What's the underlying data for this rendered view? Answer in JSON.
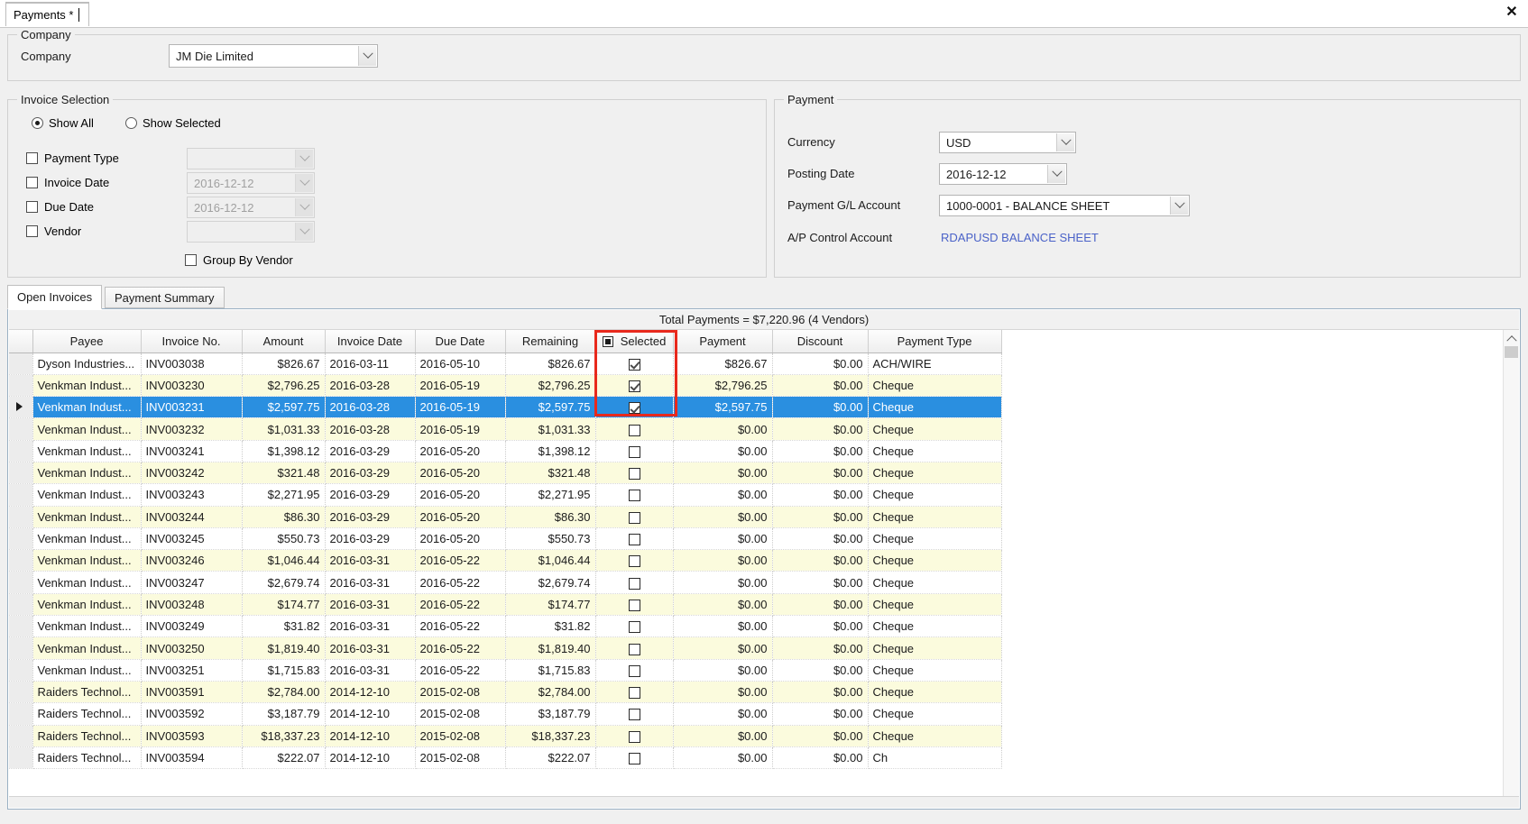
{
  "window": {
    "tab_label": "Payments *",
    "close_label": "✕"
  },
  "company_section": {
    "group_title": "Company",
    "label": "Company",
    "value": "JM Die Limited"
  },
  "invoice_selection": {
    "group_title": "Invoice Selection",
    "radio_show_all": "Show All",
    "radio_show_selected": "Show Selected",
    "filters": [
      {
        "label": "Payment Type",
        "value": "",
        "checked": false,
        "disabled": true
      },
      {
        "label": "Invoice Date",
        "value": "2016-12-12",
        "checked": false,
        "disabled": true
      },
      {
        "label": "Due Date",
        "value": "2016-12-12",
        "checked": false,
        "disabled": true
      },
      {
        "label": "Vendor",
        "value": "",
        "checked": false,
        "disabled": true
      }
    ],
    "group_by_vendor": "Group By Vendor"
  },
  "payment_section": {
    "group_title": "Payment",
    "currency_label": "Currency",
    "currency_value": "USD",
    "posting_date_label": "Posting Date",
    "posting_date_value": "2016-12-12",
    "gl_account_label": "Payment G/L Account",
    "gl_account_value": "1000-0001 - BALANCE SHEET",
    "ap_control_label": "A/P Control Account",
    "ap_control_value": "RDAPUSD BALANCE SHEET",
    "link_color": "#4a62c8"
  },
  "lower_tabs": [
    {
      "label": "Open Invoices",
      "active": true
    },
    {
      "label": "Payment Summary",
      "active": false
    }
  ],
  "grid": {
    "summary": "Total Payments = $7,220.96 (4 Vendors)",
    "columns": [
      "Payee",
      "Invoice No.",
      "Amount",
      "Invoice Date",
      "Due Date",
      "Remaining",
      "Selected",
      "Payment",
      "Discount",
      "Payment Type"
    ],
    "select_all_state": "indeterminate",
    "rows": [
      {
        "payee": "Dyson Industries...",
        "invoice_no": "INV003038",
        "amount": "$826.67",
        "invoice_date": "2016-03-11",
        "due_date": "2016-05-10",
        "remaining": "$826.67",
        "selected": true,
        "payment": "$826.67",
        "discount": "$0.00",
        "payment_type": "ACH/WIRE",
        "highlighted": false
      },
      {
        "payee": "Venkman  Indust...",
        "invoice_no": "INV003230",
        "amount": "$2,796.25",
        "invoice_date": "2016-03-28",
        "due_date": "2016-05-19",
        "remaining": "$2,796.25",
        "selected": true,
        "payment": "$2,796.25",
        "discount": "$0.00",
        "payment_type": "Cheque",
        "highlighted": false
      },
      {
        "payee": "Venkman  Indust...",
        "invoice_no": "INV003231",
        "amount": "$2,597.75",
        "invoice_date": "2016-03-28",
        "due_date": "2016-05-19",
        "remaining": "$2,597.75",
        "selected": true,
        "payment": "$2,597.75",
        "discount": "$0.00",
        "payment_type": "Cheque",
        "highlighted": true
      },
      {
        "payee": "Venkman  Indust...",
        "invoice_no": "INV003232",
        "amount": "$1,031.33",
        "invoice_date": "2016-03-28",
        "due_date": "2016-05-19",
        "remaining": "$1,031.33",
        "selected": false,
        "payment": "$0.00",
        "discount": "$0.00",
        "payment_type": "Cheque",
        "highlighted": false
      },
      {
        "payee": "Venkman  Indust...",
        "invoice_no": "INV003241",
        "amount": "$1,398.12",
        "invoice_date": "2016-03-29",
        "due_date": "2016-05-20",
        "remaining": "$1,398.12",
        "selected": false,
        "payment": "$0.00",
        "discount": "$0.00",
        "payment_type": "Cheque",
        "highlighted": false
      },
      {
        "payee": "Venkman  Indust...",
        "invoice_no": "INV003242",
        "amount": "$321.48",
        "invoice_date": "2016-03-29",
        "due_date": "2016-05-20",
        "remaining": "$321.48",
        "selected": false,
        "payment": "$0.00",
        "discount": "$0.00",
        "payment_type": "Cheque",
        "highlighted": false
      },
      {
        "payee": "Venkman  Indust...",
        "invoice_no": "INV003243",
        "amount": "$2,271.95",
        "invoice_date": "2016-03-29",
        "due_date": "2016-05-20",
        "remaining": "$2,271.95",
        "selected": false,
        "payment": "$0.00",
        "discount": "$0.00",
        "payment_type": "Cheque",
        "highlighted": false
      },
      {
        "payee": "Venkman  Indust...",
        "invoice_no": "INV003244",
        "amount": "$86.30",
        "invoice_date": "2016-03-29",
        "due_date": "2016-05-20",
        "remaining": "$86.30",
        "selected": false,
        "payment": "$0.00",
        "discount": "$0.00",
        "payment_type": "Cheque",
        "highlighted": false
      },
      {
        "payee": "Venkman  Indust...",
        "invoice_no": "INV003245",
        "amount": "$550.73",
        "invoice_date": "2016-03-29",
        "due_date": "2016-05-20",
        "remaining": "$550.73",
        "selected": false,
        "payment": "$0.00",
        "discount": "$0.00",
        "payment_type": "Cheque",
        "highlighted": false
      },
      {
        "payee": "Venkman  Indust...",
        "invoice_no": "INV003246",
        "amount": "$1,046.44",
        "invoice_date": "2016-03-31",
        "due_date": "2016-05-22",
        "remaining": "$1,046.44",
        "selected": false,
        "payment": "$0.00",
        "discount": "$0.00",
        "payment_type": "Cheque",
        "highlighted": false
      },
      {
        "payee": "Venkman  Indust...",
        "invoice_no": "INV003247",
        "amount": "$2,679.74",
        "invoice_date": "2016-03-31",
        "due_date": "2016-05-22",
        "remaining": "$2,679.74",
        "selected": false,
        "payment": "$0.00",
        "discount": "$0.00",
        "payment_type": "Cheque",
        "highlighted": false
      },
      {
        "payee": "Venkman  Indust...",
        "invoice_no": "INV003248",
        "amount": "$174.77",
        "invoice_date": "2016-03-31",
        "due_date": "2016-05-22",
        "remaining": "$174.77",
        "selected": false,
        "payment": "$0.00",
        "discount": "$0.00",
        "payment_type": "Cheque",
        "highlighted": false
      },
      {
        "payee": "Venkman  Indust...",
        "invoice_no": "INV003249",
        "amount": "$31.82",
        "invoice_date": "2016-03-31",
        "due_date": "2016-05-22",
        "remaining": "$31.82",
        "selected": false,
        "payment": "$0.00",
        "discount": "$0.00",
        "payment_type": "Cheque",
        "highlighted": false
      },
      {
        "payee": "Venkman  Indust...",
        "invoice_no": "INV003250",
        "amount": "$1,819.40",
        "invoice_date": "2016-03-31",
        "due_date": "2016-05-22",
        "remaining": "$1,819.40",
        "selected": false,
        "payment": "$0.00",
        "discount": "$0.00",
        "payment_type": "Cheque",
        "highlighted": false
      },
      {
        "payee": "Venkman  Indust...",
        "invoice_no": "INV003251",
        "amount": "$1,715.83",
        "invoice_date": "2016-03-31",
        "due_date": "2016-05-22",
        "remaining": "$1,715.83",
        "selected": false,
        "payment": "$0.00",
        "discount": "$0.00",
        "payment_type": "Cheque",
        "highlighted": false
      },
      {
        "payee": "Raiders Technol...",
        "invoice_no": "INV003591",
        "amount": "$2,784.00",
        "invoice_date": "2014-12-10",
        "due_date": "2015-02-08",
        "remaining": "$2,784.00",
        "selected": false,
        "payment": "$0.00",
        "discount": "$0.00",
        "payment_type": "Cheque",
        "highlighted": false
      },
      {
        "payee": "Raiders Technol...",
        "invoice_no": "INV003592",
        "amount": "$3,187.79",
        "invoice_date": "2014-12-10",
        "due_date": "2015-02-08",
        "remaining": "$3,187.79",
        "selected": false,
        "payment": "$0.00",
        "discount": "$0.00",
        "payment_type": "Cheque",
        "highlighted": false
      },
      {
        "payee": "Raiders Technol...",
        "invoice_no": "INV003593",
        "amount": "$18,337.23",
        "invoice_date": "2014-12-10",
        "due_date": "2015-02-08",
        "remaining": "$18,337.23",
        "selected": false,
        "payment": "$0.00",
        "discount": "$0.00",
        "payment_type": "Cheque",
        "highlighted": false
      },
      {
        "payee": "Raiders Technol...",
        "invoice_no": "INV003594",
        "amount": "$222.07",
        "invoice_date": "2014-12-10",
        "due_date": "2015-02-08",
        "remaining": "$222.07",
        "selected": false,
        "payment": "$0.00",
        "discount": "$0.00",
        "payment_type": "Ch",
        "highlighted": false
      }
    ]
  },
  "annotation": {
    "color": "#e8291c"
  }
}
